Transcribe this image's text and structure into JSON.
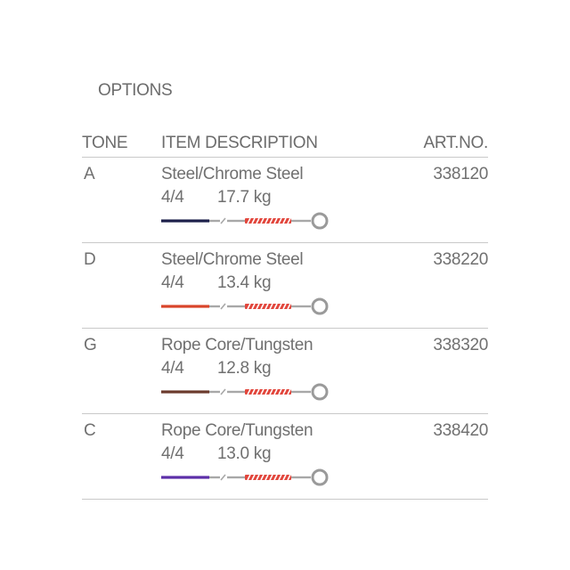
{
  "heading": "OPTIONS",
  "columns": {
    "tone": "TONE",
    "description": "ITEM DESCRIPTION",
    "art_no": "ART.NO."
  },
  "rows": [
    {
      "tone": "A",
      "material": "Steel/Chrome Steel",
      "size": "4/4",
      "tension": "17.7 kg",
      "art_no": "338120",
      "silk_color": "#1c1f4a",
      "icon": "string-winding-icon"
    },
    {
      "tone": "D",
      "material": "Steel/Chrome Steel",
      "size": "4/4",
      "tension": "13.4 kg",
      "art_no": "338220",
      "silk_color": "#d9442a",
      "icon": "string-winding-icon"
    },
    {
      "tone": "G",
      "material": "Rope Core/Tungsten",
      "size": "4/4",
      "tension": "12.8 kg",
      "art_no": "338320",
      "silk_color": "#6b3a2c",
      "icon": "string-winding-icon"
    },
    {
      "tone": "C",
      "material": "Rope Core/Tungsten",
      "size": "4/4",
      "tension": "13.0 kg",
      "art_no": "338420",
      "silk_color": "#5c2fa8",
      "icon": "string-winding-icon"
    }
  ],
  "colors": {
    "text": "#707070",
    "rule": "#c9c9c9",
    "winding_red": "#e2463c",
    "winding_white": "#ffffff",
    "metal": "#a8a8a8",
    "ring": "#9a9a9a"
  }
}
